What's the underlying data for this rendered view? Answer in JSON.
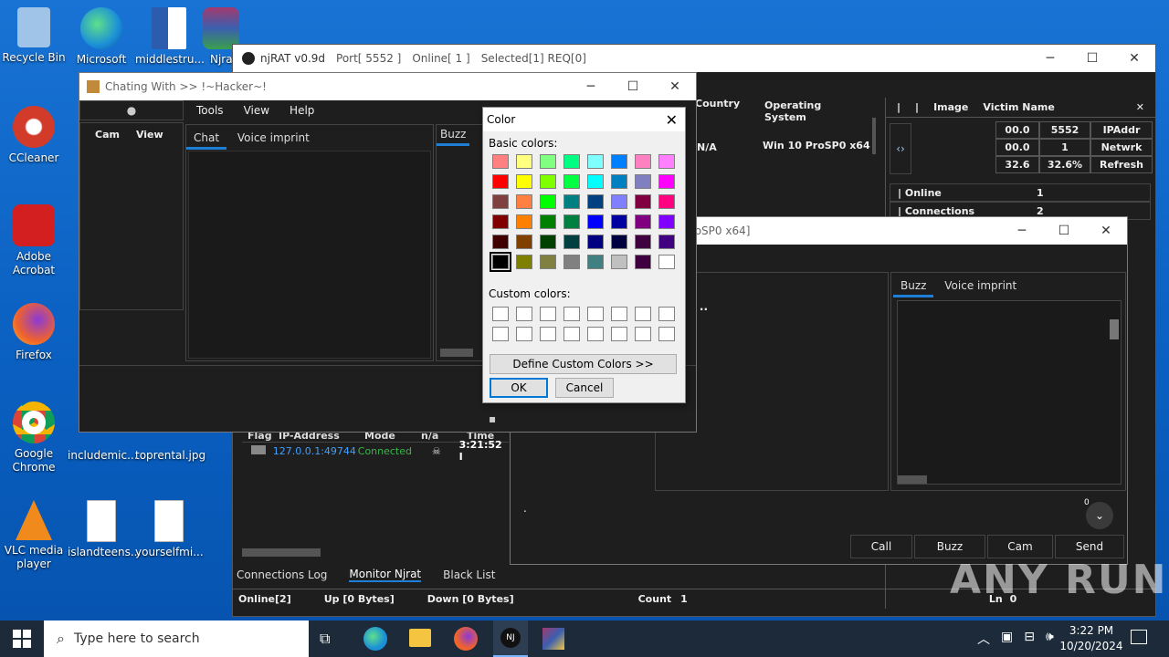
{
  "desktop": {
    "icons": [
      {
        "name": "recycle-bin",
        "label": "Recycle Bin",
        "color": "#9fc4e8"
      },
      {
        "name": "edge",
        "label": "Microsoft Edge",
        "color": "#1b8fd8"
      },
      {
        "name": "word-doc",
        "label": "middlestru...",
        "color": "#2b5cad"
      },
      {
        "name": "winrar",
        "label": "Njrat",
        "color": "#a33a6e"
      },
      {
        "name": "ccleaner",
        "label": "CCleaner",
        "color": "#d23a2a"
      },
      {
        "name": "acrobat",
        "label": "Adobe Acrobat",
        "color": "#d31f1f"
      },
      {
        "name": "firefox",
        "label": "Firefox",
        "color": "#f0632b"
      },
      {
        "name": "chrome",
        "label": "Google Chrome",
        "color": "#3a9b45"
      },
      {
        "name": "file-includemic",
        "label": "includemic...",
        "color": "#ffffff"
      },
      {
        "name": "file-toprental",
        "label": "toprental.jpg",
        "color": "#ffffff"
      },
      {
        "name": "vlc",
        "label": "VLC media player",
        "color": "#f08a1c"
      },
      {
        "name": "file-islandteens",
        "label": "islandteens...",
        "color": "#ffffff"
      },
      {
        "name": "file-yourselfmi",
        "label": "yourselfmi...",
        "color": "#ffffff"
      }
    ]
  },
  "njrat": {
    "title": "njRAT v0.9d",
    "port": "Port[ 5552 ]",
    "online": "Online[ 1 ]",
    "selected": "Selected[1] REQ[0]",
    "headers": {
      "country": "Country",
      "os": "Operating System",
      "image": "Image",
      "victim": "Victim Name"
    },
    "row": {
      "country": "N/A",
      "os": "Win 10 ProSP0 x64"
    },
    "stats": [
      [
        "00.0",
        "5552",
        "IPAddr"
      ],
      [
        "00.0",
        "1",
        "Netwrk"
      ],
      [
        "32.6",
        "32.6%",
        "Refresh"
      ]
    ],
    "info": [
      {
        "k": "Online",
        "v": "1"
      },
      {
        "k": "Connections",
        "v": "2"
      }
    ],
    "log_headers": {
      "flag": "Flag",
      "ip": "IP-Address",
      "mode": "Mode",
      "na": "n/a",
      "time": "Time"
    },
    "log_row": {
      "ip": "127.0.0.1:49744",
      "mode": "Connected",
      "time": "3:21:52 I"
    },
    "bottom_tabs": [
      "Connections Log",
      "Monitor Njrat",
      "Black List"
    ],
    "status": {
      "online": "Online[2]",
      "up": "Up [0 Bytes]",
      "down": "Down [0 Bytes]",
      "count_label": "Count",
      "count": "1",
      "ln": "Ln",
      "ln_val": "0"
    }
  },
  "chat2": {
    "title_fragment": "ProSP0 x64]",
    "tabs": [
      "Buzz",
      "Voice imprint"
    ],
    "connected": "ected ..",
    "dot": ".",
    "badge": "0",
    "buttons": [
      "Call",
      "Buzz",
      "Cam",
      "Send"
    ]
  },
  "chat": {
    "title": "Chating With >> !~Hacker~!",
    "menu": [
      "Tools",
      "View",
      "Help"
    ],
    "left_menu": [
      "Cam",
      "View"
    ],
    "tabs": [
      "Chat",
      "Voice imprint"
    ],
    "buzz_tab": "Buzz"
  },
  "color_dialog": {
    "title": "Color",
    "basic_label": "Basic colors:",
    "custom_label": "Custom colors:",
    "define_label": "Define Custom Colors >>",
    "ok": "OK",
    "cancel": "Cancel",
    "basic_colors": [
      [
        "#ff8080",
        "#ffff80",
        "#80ff80",
        "#00ff80",
        "#80ffff",
        "#0080ff",
        "#ff80c0",
        "#ff80ff"
      ],
      [
        "#ff0000",
        "#ffff00",
        "#80ff00",
        "#00ff40",
        "#00ffff",
        "#0080c0",
        "#8080c0",
        "#ff00ff"
      ],
      [
        "#804040",
        "#ff8040",
        "#00ff00",
        "#008080",
        "#004080",
        "#8080ff",
        "#800040",
        "#ff0080"
      ],
      [
        "#800000",
        "#ff8000",
        "#008000",
        "#008040",
        "#0000ff",
        "#0000a0",
        "#800080",
        "#8000ff"
      ],
      [
        "#400000",
        "#804000",
        "#004000",
        "#004040",
        "#000080",
        "#000040",
        "#400040",
        "#400080"
      ],
      [
        "#000000",
        "#808000",
        "#808040",
        "#808080",
        "#408080",
        "#c0c0c0",
        "#400040",
        "#ffffff"
      ]
    ],
    "selected_index": 40
  },
  "taskbar": {
    "search_placeholder": "Type here to search",
    "time": "3:22 PM",
    "date": "10/20/2024"
  },
  "watermark": "ANY RUN"
}
